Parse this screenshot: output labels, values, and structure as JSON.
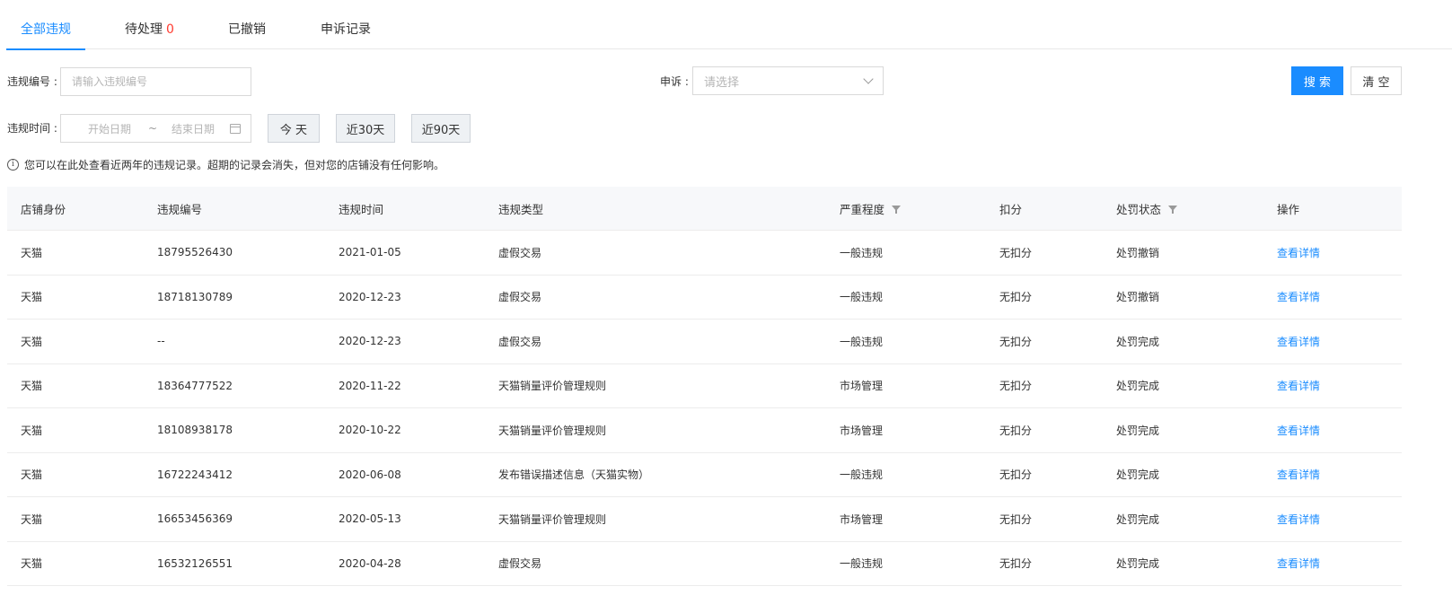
{
  "tabs": [
    {
      "label": "全部违规",
      "active": true
    },
    {
      "label": "待处理",
      "count": "0",
      "active": false
    },
    {
      "label": "已撤销",
      "active": false
    },
    {
      "label": "申诉记录",
      "active": false
    }
  ],
  "filters": {
    "violation_no_label": "违规编号 :",
    "violation_no_placeholder": "请输入违规编号",
    "appeal_label": "申诉 :",
    "appeal_placeholder": "请选择",
    "search_label": "搜 索",
    "clear_label": "清 空",
    "time_label": "违规时间 :",
    "start_placeholder": "开始日期",
    "range_sep": "~",
    "end_placeholder": "结束日期",
    "today_label": "今 天",
    "last30_label": "近30天",
    "last90_label": "近90天"
  },
  "notice": "您可以在此处查看近两年的违规记录。超期的记录会消失，但对您的店铺没有任何影响。",
  "table": {
    "headers": [
      "店铺身份",
      "违规编号",
      "违规时间",
      "违规类型",
      "严重程度",
      "扣分",
      "处罚状态",
      "操作"
    ],
    "rows": [
      [
        "天猫",
        "18795526430",
        "2021-01-05",
        "虚假交易",
        "一般违规",
        "无扣分",
        "处罚撤销",
        "查看详情"
      ],
      [
        "天猫",
        "18718130789",
        "2020-12-23",
        "虚假交易",
        "一般违规",
        "无扣分",
        "处罚撤销",
        "查看详情"
      ],
      [
        "天猫",
        "--",
        "2020-12-23",
        "虚假交易",
        "一般违规",
        "无扣分",
        "处罚完成",
        "查看详情"
      ],
      [
        "天猫",
        "18364777522",
        "2020-11-22",
        "天猫销量评价管理规则",
        "市场管理",
        "无扣分",
        "处罚完成",
        "查看详情"
      ],
      [
        "天猫",
        "18108938178",
        "2020-10-22",
        "天猫销量评价管理规则",
        "市场管理",
        "无扣分",
        "处罚完成",
        "查看详情"
      ],
      [
        "天猫",
        "16722243412",
        "2020-06-08",
        "发布错误描述信息（天猫实物）",
        "一般违规",
        "无扣分",
        "处罚完成",
        "查看详情"
      ],
      [
        "天猫",
        "16653456369",
        "2020-05-13",
        "天猫销量评价管理规则",
        "市场管理",
        "无扣分",
        "处罚完成",
        "查看详情"
      ],
      [
        "天猫",
        "16532126551",
        "2020-04-28",
        "虚假交易",
        "一般违规",
        "无扣分",
        "处罚完成",
        "查看详情"
      ]
    ]
  },
  "colors": {
    "accent": "#1a8cff",
    "count": "#ff3b30"
  }
}
